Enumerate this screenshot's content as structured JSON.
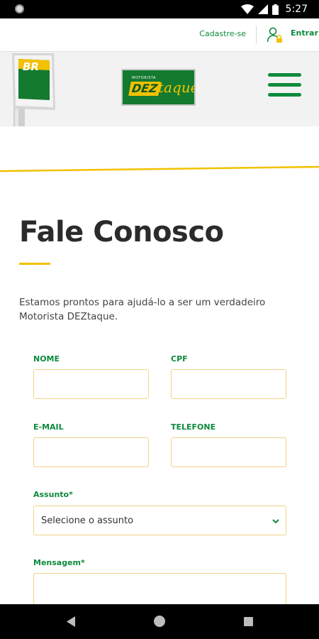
{
  "status_bar": {
    "time": "5:27"
  },
  "top_links": {
    "register_label": "Cadastre-se",
    "login_label": "Entrar"
  },
  "header": {
    "brand_sign_text": "BR",
    "logo_small_text": "MOTORISTA",
    "logo_dez": "DEZ",
    "logo_taque": "taque"
  },
  "page": {
    "title": "Fale Conosco",
    "intro": "Estamos prontos para ajudá-lo a ser um verdadeiro Motorista DEZtaque."
  },
  "form": {
    "name_label": "NOME",
    "cpf_label": "CPF",
    "email_label": "E-MAIL",
    "phone_label": "TELEFONE",
    "subject_label": "Assunto*",
    "subject_selected": "Selecione o assunto",
    "message_label": "Mensagem*"
  },
  "colors": {
    "accent_green": "#0d8a3c",
    "accent_yellow": "#f2c100"
  }
}
